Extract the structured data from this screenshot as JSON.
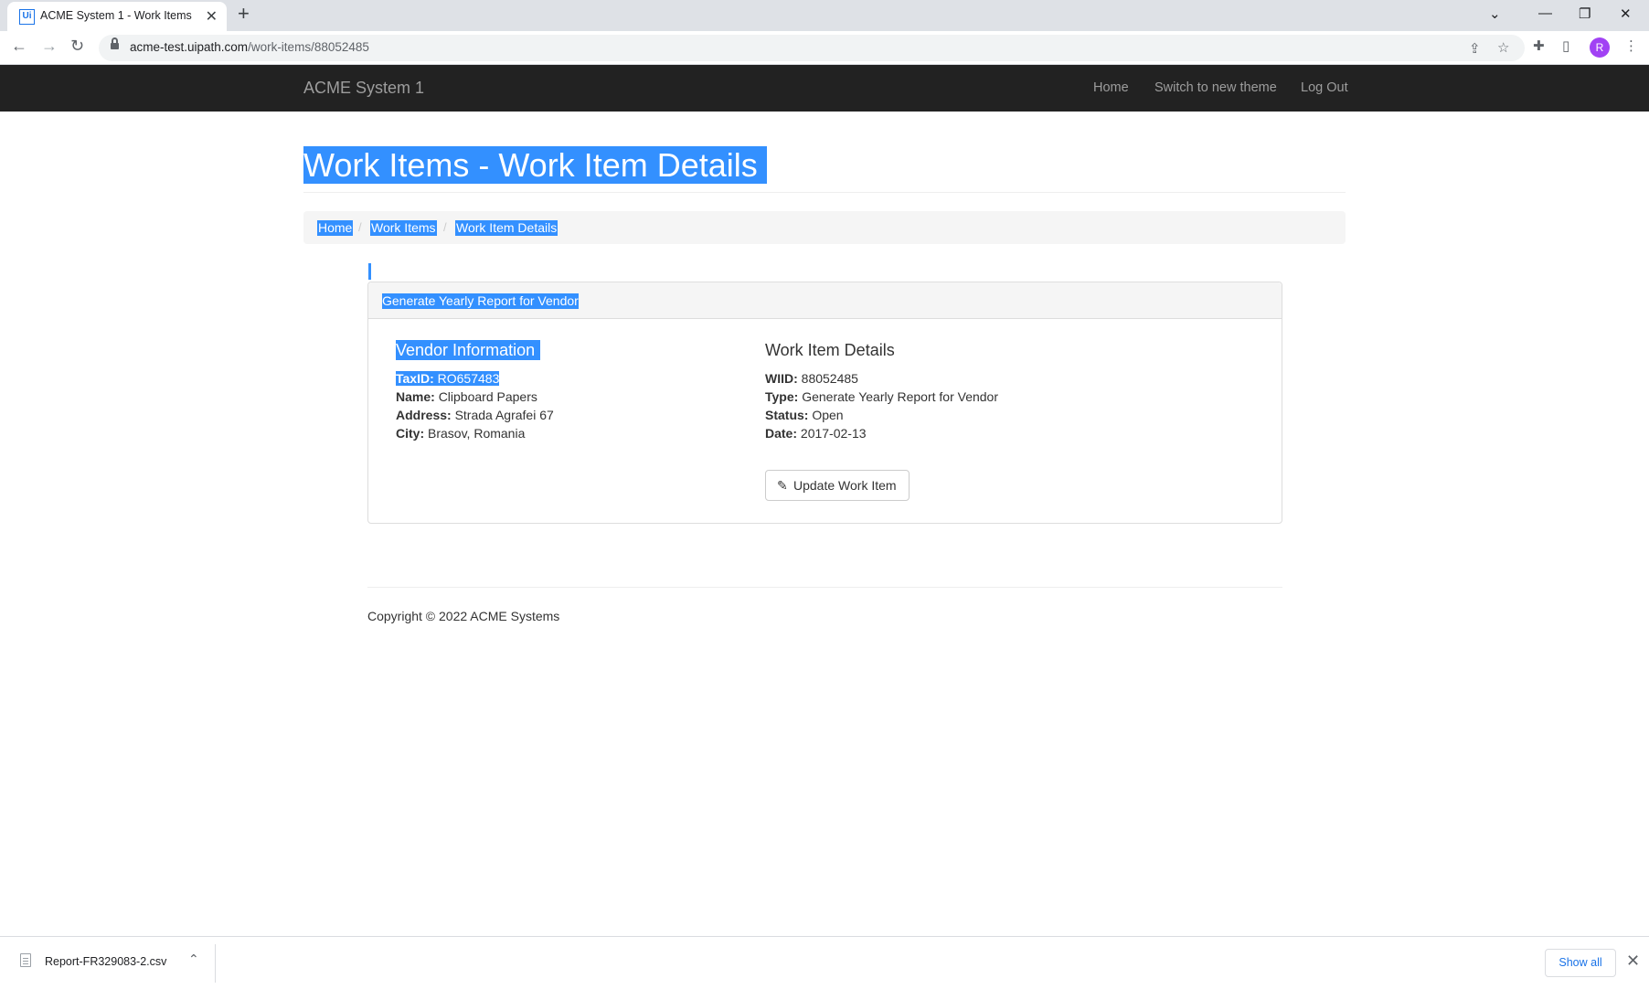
{
  "browser": {
    "tab_title": "ACME System 1 - Work Items",
    "favicon_text": "Ui",
    "url_host": "acme-test.uipath.com",
    "url_path": "/work-items/88052485",
    "profile_initial": "R"
  },
  "navbar": {
    "brand": "ACME System 1",
    "links": [
      "Home",
      "Switch to new theme",
      "Log Out"
    ]
  },
  "page": {
    "title": "Work Items - Work Item Details",
    "breadcrumb": [
      "Home",
      "Work Items",
      "Work Item Details"
    ],
    "breadcrumb_separator": "/"
  },
  "panel": {
    "heading": "Generate Yearly Report for Vendor",
    "vendor": {
      "title": "Vendor Information",
      "fields": [
        {
          "label": "TaxID:",
          "value": "RO657483"
        },
        {
          "label": "Name:",
          "value": "Clipboard Papers"
        },
        {
          "label": "Address:",
          "value": "Strada Agrafei 67"
        },
        {
          "label": "City:",
          "value": "Brasov, Romania"
        }
      ]
    },
    "details": {
      "title": "Work Item Details",
      "fields": [
        {
          "label": "WIID:",
          "value": "88052485"
        },
        {
          "label": "Type:",
          "value": "Generate Yearly Report for Vendor"
        },
        {
          "label": "Status:",
          "value": "Open"
        },
        {
          "label": "Date:",
          "value": "2017-02-13"
        }
      ]
    },
    "update_button": "Update Work Item"
  },
  "footer": {
    "copyright": "Copyright © 2022 ACME Systems"
  },
  "downloads": {
    "file": "Report-FR329083-2.csv",
    "show_all": "Show all"
  },
  "colors": {
    "selection": "#3390ff",
    "navbar_bg": "#222222",
    "nav_text": "#9d9d9d"
  }
}
